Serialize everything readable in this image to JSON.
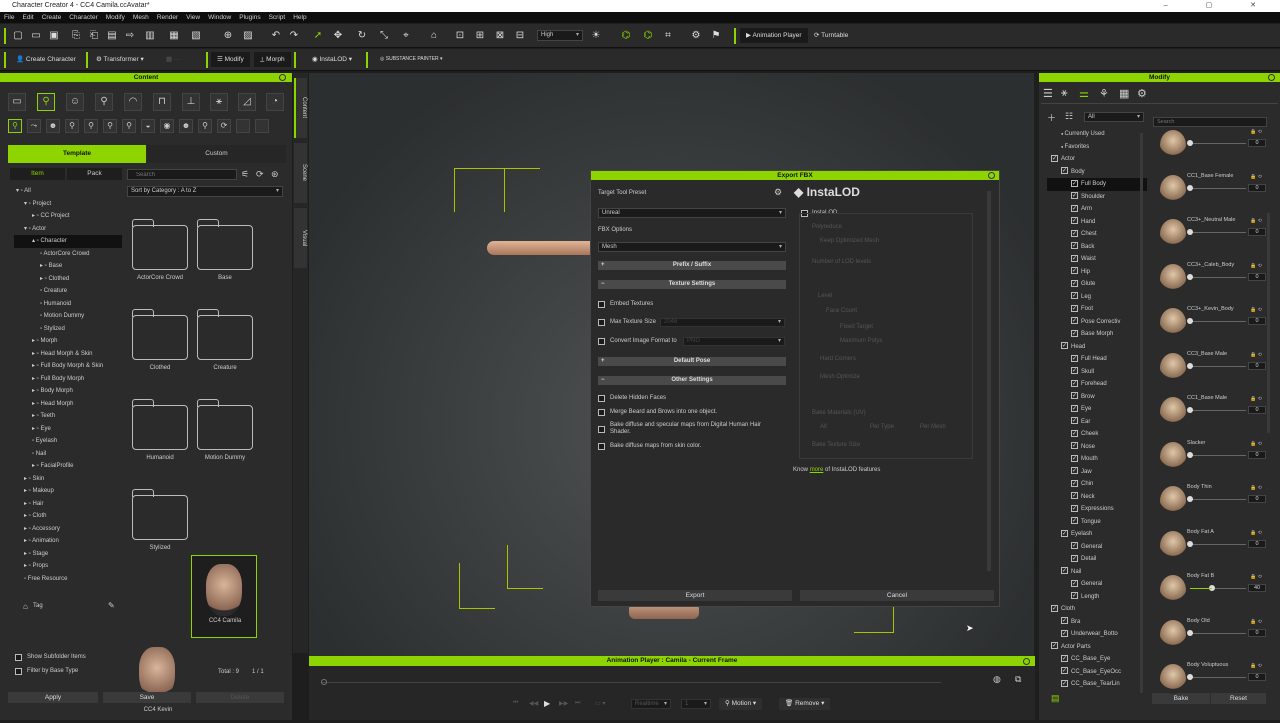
{
  "window": {
    "title": "Character Creator 4 - CC4 Camila.ccAvatar*",
    "controls": "–  ▢  ✕"
  },
  "menu": [
    "File",
    "Edit",
    "Create",
    "Character",
    "Modify",
    "Mesh",
    "Render",
    "View",
    "Window",
    "Plugins",
    "Script",
    "Help"
  ],
  "toolbar": {
    "quality": "High",
    "animation_player": "Animation Player",
    "turntable": "Turntable"
  },
  "toolbar2": {
    "create_character": "Create Character",
    "transformer": "Transformer",
    "modify": "Modify",
    "morph": "Morph",
    "instalod": "InstaLOD",
    "substance": "SUBSTANCE PAINTER"
  },
  "content": {
    "title": "Content",
    "tab_template": "Template",
    "tab_custom": "Custom",
    "tab_item": "Item",
    "tab_pack": "Pack",
    "search_placeholder": "Search",
    "sort": "Sort by Category : A to Z",
    "tree": [
      "All",
      "Project",
      "CC Project",
      "Actor",
      "Character",
      "ActorCore Crowd",
      "Base",
      "Clothed",
      "Creature",
      "Humanoid",
      "Motion Dummy",
      "Stylized",
      "Morph",
      "Head Morph & Skin",
      "Full Body Morph & Skin",
      "Full Body Morph",
      "Body Morph",
      "Head Morph",
      "Teeth",
      "Eye",
      "Eyelash",
      "Nail",
      "FacialProfile",
      "Skin",
      "Makeup",
      "Hair",
      "Cloth",
      "Accessory",
      "Animation",
      "Stage",
      "Props",
      "Free Resource"
    ],
    "thumbs": [
      "ActorCore Crowd",
      "Base",
      "Clothed",
      "Creature",
      "Humanoid",
      "Motion Dummy",
      "Stylized",
      "CC4 Camila",
      "CC4 Kevin"
    ],
    "tag": "Tag",
    "show_subfolder": "Show Subfolder Items",
    "filter_base": "Filter by Base Type",
    "total": "Total : 9",
    "page": "1 / 1",
    "apply": "Apply",
    "save": "Save",
    "delete": "Delete"
  },
  "side_tabs": [
    "Content",
    "Scene",
    "Visual"
  ],
  "export": {
    "title": "Export FBX",
    "target_preset_label": "Target Tool Preset",
    "target_preset": "Unreal",
    "fbx_options_label": "FBX Options",
    "fbx_option": "Mesh",
    "prefix": "Prefix / Suffix",
    "texture_settings": "Texture Settings",
    "embed_textures": "Embed Textures",
    "max_texture": "Max Texture Size",
    "max_texture_val": "2048",
    "convert_format": "Convert Image Format to",
    "convert_val": "PNG",
    "default_pose": "Default Pose",
    "other_settings": "Other Settings",
    "delete_hidden": "Delete Hidden Faces",
    "merge_beard": "Merge Beard and Brows into one object.",
    "bake_diffuse_dh": "Bake diffuse and specular maps from Digital Human Hair Shader.",
    "bake_skin": "Bake diffuse maps from skin color.",
    "export_btn": "Export",
    "cancel_btn": "Cancel",
    "instalod": "InstaLOD",
    "instalod_check": "InstaLOD",
    "know_more_pre": "Know ",
    "know_more_link": "more",
    "know_more_post": " of InstaLOD features",
    "lod_rows": [
      "Polyreduce",
      "Keep Optimized Mesh",
      "Number of LOD levels",
      "Level",
      "Face Count",
      "Fixed Target",
      "Maximum Polys",
      "Hard Corners",
      "Mesh Optimize",
      "Bake Materials (UV)",
      "All",
      "Per Type",
      "Per Mesh",
      "Bake Texture Size"
    ]
  },
  "anim": {
    "title": "Animation Player : Camila - Current Frame",
    "realtime": "Realtime",
    "motion": "Motion",
    "remove": "Remove",
    "frame": "1"
  },
  "modify": {
    "title": "Modify",
    "scope": "All",
    "search_placeholder": "Search",
    "tree": [
      "Currently Used",
      "Favorites",
      "Actor",
      "Body",
      "Full Body",
      "Shoulder",
      "Arm",
      "Hand",
      "Chest",
      "Back",
      "Waist",
      "Hip",
      "Glute",
      "Leg",
      "Foot",
      "Pose Correctiv",
      "Base Morph",
      "Head",
      "Full Head",
      "Skull",
      "Forehead",
      "Brow",
      "Eye",
      "Ear",
      "Cheek",
      "Nose",
      "Mouth",
      "Jaw",
      "Chin",
      "Neck",
      "Expressions",
      "Tongue",
      "Eyelash",
      "General",
      "Detail",
      "Nail",
      "General",
      "Length",
      "Cloth",
      "Bra",
      "Underwear_Botto",
      "Actor Parts",
      "CC_Base_Eye",
      "CC_Base_EyeOcc",
      "CC_Base_TearLin"
    ],
    "morphs": [
      {
        "name": "",
        "value": "0"
      },
      {
        "name": "CC1_Base Female",
        "value": "0"
      },
      {
        "name": "CC3+_Neutral Male",
        "value": "0"
      },
      {
        "name": "CC3+_Caleb_Body",
        "value": "0"
      },
      {
        "name": "CC3+_Kevin_Body",
        "value": "0"
      },
      {
        "name": "CC3_Base Male",
        "value": "0"
      },
      {
        "name": "CC1_Base Male",
        "value": "0"
      },
      {
        "name": "Slacker",
        "value": "0"
      },
      {
        "name": "Body Thin",
        "value": "0"
      },
      {
        "name": "Body Fat A",
        "value": "0"
      },
      {
        "name": "Body Fat B",
        "value": "40"
      },
      {
        "name": "Body Old",
        "value": "0"
      },
      {
        "name": "Body Voluptuous",
        "value": "0"
      }
    ],
    "bake": "Bake",
    "reset": "Reset"
  }
}
